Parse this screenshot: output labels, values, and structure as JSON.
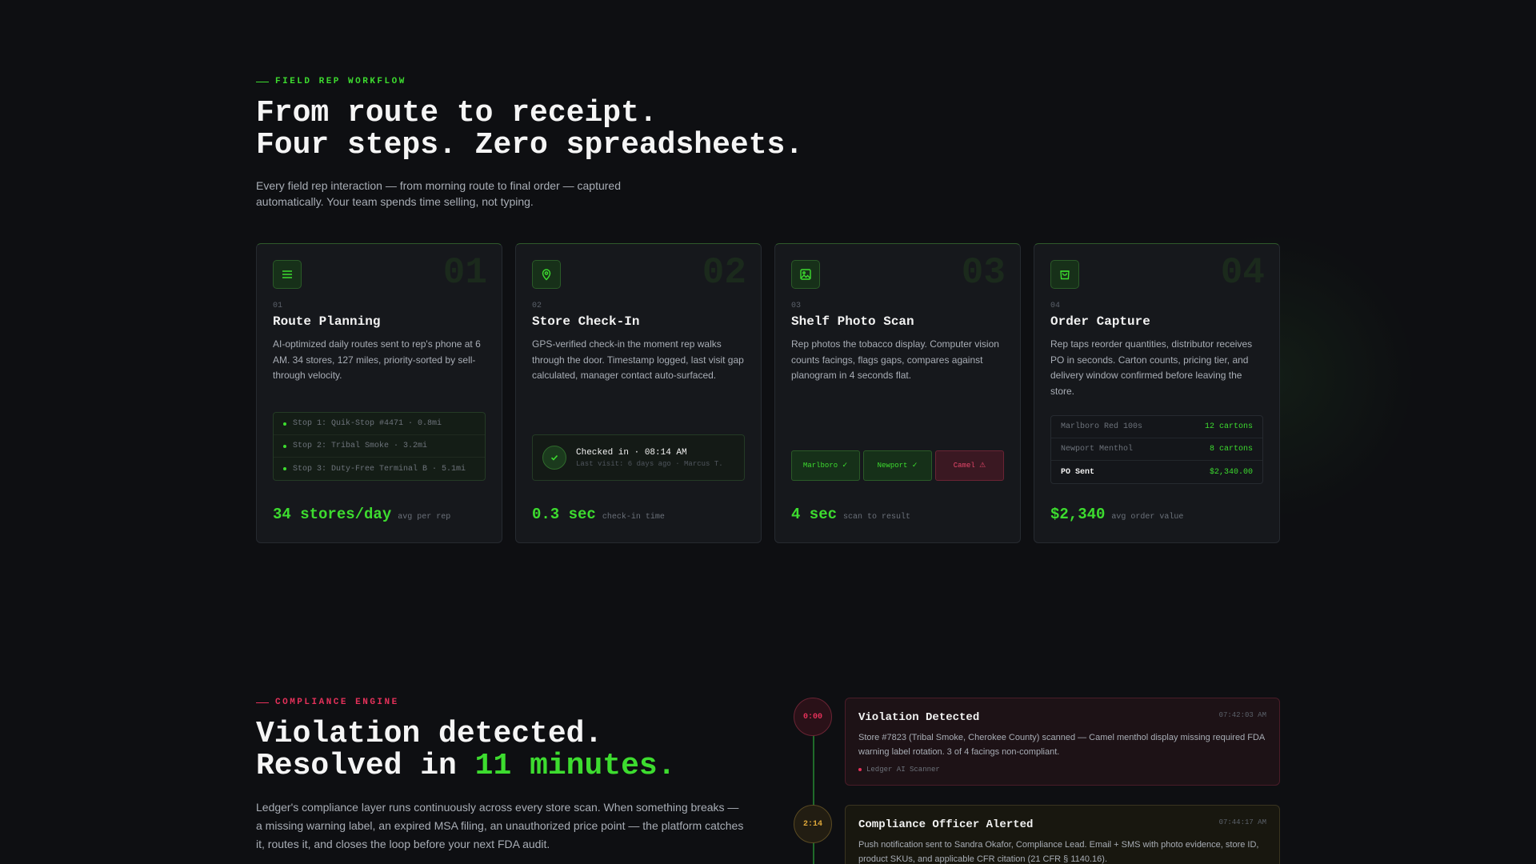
{
  "workflow": {
    "eyebrow": "FIELD REP WORKFLOW",
    "title_line1": "From route to receipt.",
    "title_line2": "Four steps. Zero spreadsheets.",
    "lead": "Every field rep interaction — from morning route to final order — captured automatically. Your team spends time selling, not typing.",
    "cards": [
      {
        "number": "01",
        "icon": "list-icon",
        "title": "Route Planning",
        "desc": "AI-optimized daily routes sent to rep's phone at 6 AM. 34 stores, 127 miles, priority-sorted by sell-through velocity.",
        "stops": [
          "Stop 1: Quik-Stop #4471 · 0.8mi",
          "Stop 2: Tribal Smoke · 3.2mi",
          "Stop 3: Duty-Free Terminal B · 5.1mi"
        ],
        "stat_value": "34 stores/day",
        "stat_unit": "avg per rep"
      },
      {
        "number": "02",
        "icon": "map-pin-icon",
        "title": "Store Check-In",
        "desc": "GPS-verified check-in the moment rep walks through the door. Timestamp logged, last visit gap calculated, manager contact auto-surfaced.",
        "checkin_title": "Checked in · 08:14 AM",
        "checkin_sub": "Last visit: 6 days ago · Marcus T.",
        "stat_value": "0.3 sec",
        "stat_unit": "check-in time"
      },
      {
        "number": "03",
        "icon": "image-icon",
        "title": "Shelf Photo Scan",
        "desc": "Rep photos the tobacco display. Computer vision counts facings, flags gaps, compares against planogram in 4 seconds flat.",
        "brands": [
          {
            "label": "Marlboro ✓",
            "status": "ok"
          },
          {
            "label": "Newport ✓",
            "status": "ok"
          },
          {
            "label": "Camel ⚠",
            "status": "bad"
          }
        ],
        "stat_value": "4 sec",
        "stat_unit": "scan to result"
      },
      {
        "number": "04",
        "icon": "shopping-bag-icon",
        "title": "Order Capture",
        "desc": "Rep taps reorder quantities, distributor receives PO in seconds. Carton counts, pricing tier, and delivery window confirmed before leaving the store.",
        "order_rows": [
          {
            "k": "Marlboro Red 100s",
            "v": "12 cartons"
          },
          {
            "k": "Newport Menthol",
            "v": "8 cartons"
          },
          {
            "k": "PO Sent",
            "v": "$2,340.00"
          }
        ],
        "stat_value": "$2,340",
        "stat_unit": "avg order value"
      }
    ]
  },
  "compliance": {
    "eyebrow": "COMPLIANCE ENGINE",
    "title_line1": "Violation detected.",
    "title_line2_prefix": "Resolved in ",
    "title_line2_highlight": "11 minutes.",
    "lead": "Ledger's compliance layer runs continuously across every store scan. When something breaks — a missing warning label, an expired MSA filing, an unauthorized price point — the platform catches it, routes it, and closes the loop before your next FDA audit.",
    "timeline": [
      {
        "badge": "0:00",
        "tone": "red",
        "title": "Violation Detected",
        "time": "07:42:03 AM",
        "body": "Store #7823 (Tribal Smoke, Cherokee County) scanned — Camel menthol display missing required FDA warning label rotation. 3 of 4 facings non-compliant.",
        "source": "Ledger AI Scanner"
      },
      {
        "badge": "2:14",
        "tone": "amber",
        "title": "Compliance Officer Alerted",
        "time": "07:44:17 AM",
        "body": "Push notification sent to Sandra Okafor, Compliance Lead. Email + SMS with photo evidence, store ID, product SKUs, and applicable CFR citation (21 CFR § 1140.16)."
      }
    ]
  },
  "colors": {
    "accent": "#3ddc2f",
    "alert": "#e5315a",
    "warning": "#e0a93a",
    "background": "#0e0f12"
  }
}
